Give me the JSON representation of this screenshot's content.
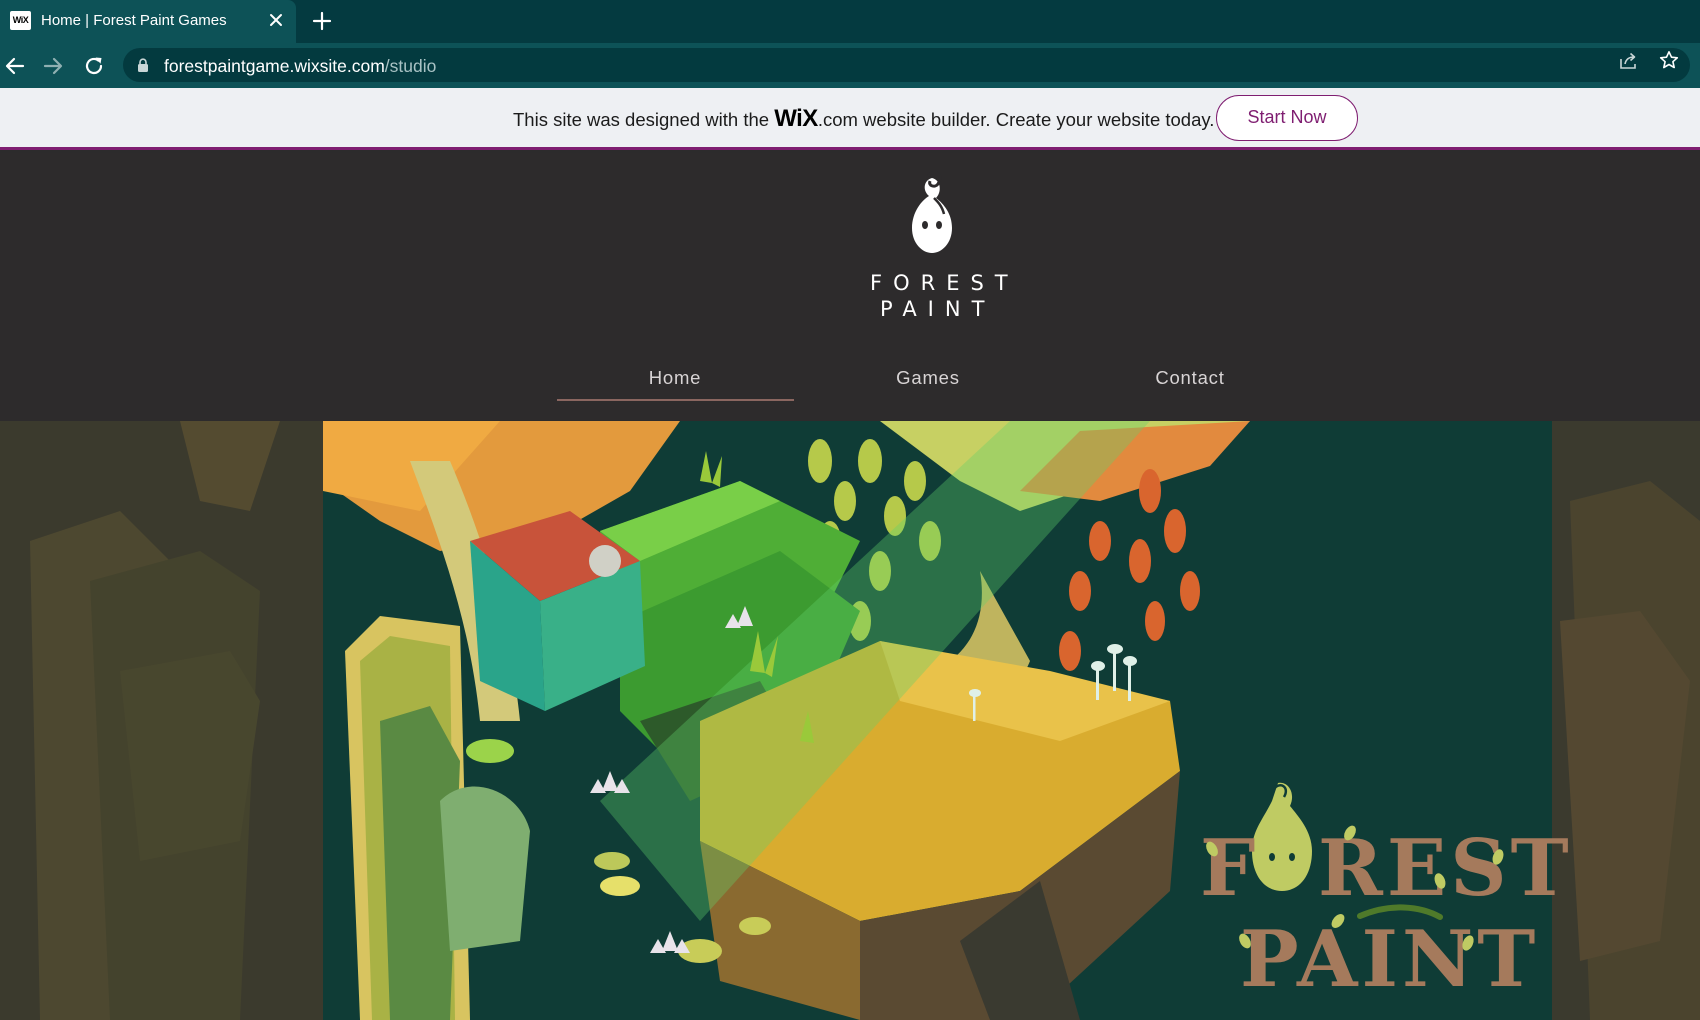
{
  "browser": {
    "tab": {
      "title": "Home | Forest Paint Games",
      "favicon_text": "WiX"
    },
    "url": {
      "host": "forestpaintgame.wixsite.com",
      "path": "/studio"
    }
  },
  "wix_banner": {
    "text_before": "This site was designed with the ",
    "logo": "WiX",
    "dotcom": ".com",
    "text_after": " website builder. Create your website today.",
    "button": "Start Now"
  },
  "site": {
    "logo_line1": "FOREST",
    "logo_line2": "PAINT",
    "nav": {
      "home": "Home",
      "games": "Games",
      "contact": "Contact"
    }
  },
  "hero": {
    "title_line1": "FOREST",
    "title_line2": "PAINT"
  },
  "colors": {
    "tab_bar": "#043a40",
    "toolbar": "#0d5257",
    "wix_accent": "#7f1e71",
    "header_bg": "#2d2b2c",
    "hero_bg": "#0f3c36",
    "title_brown": "#a57a5c",
    "title_green": "#bfcb63"
  }
}
